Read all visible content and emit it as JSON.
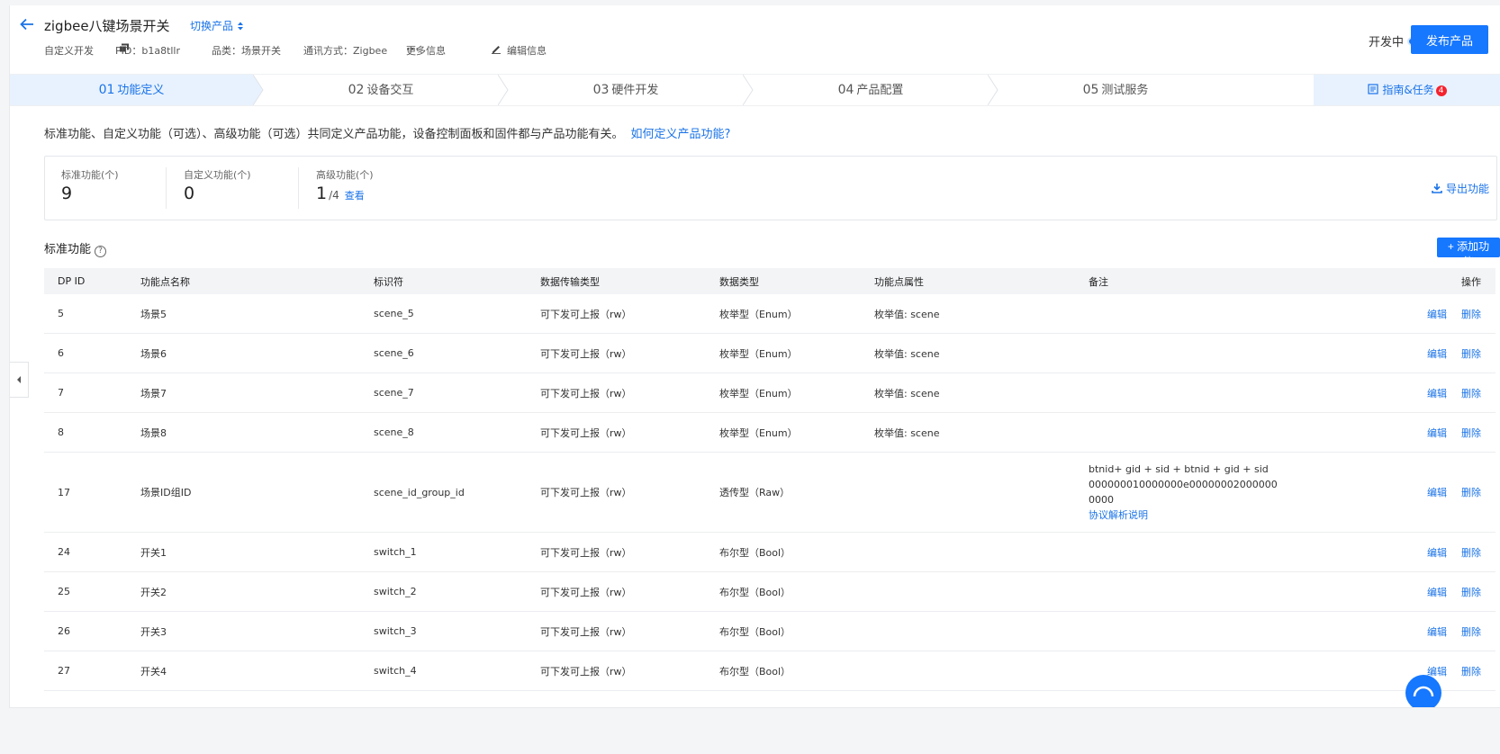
{
  "header": {
    "title": "zigbee八键场景开关",
    "switch_product": "切换产品",
    "meta": {
      "dev_type": "自定义开发",
      "pid": "PID：b1a8tllr",
      "category": "品类：场景开关",
      "protocol": "通讯方式：Zigbee",
      "more": "更多信息",
      "edit": "编辑信息"
    },
    "status": "开发中",
    "publish": "发布产品"
  },
  "steps": [
    {
      "num": "01",
      "label": "功能定义"
    },
    {
      "num": "02",
      "label": "设备交互"
    },
    {
      "num": "03",
      "label": "硬件开发"
    },
    {
      "num": "04",
      "label": "产品配置"
    },
    {
      "num": "05",
      "label": "测试服务"
    }
  ],
  "guide": {
    "label": "指南&任务",
    "badge": "4"
  },
  "intro": {
    "text": "标准功能、自定义功能（可选）、高级功能（可选）共同定义产品功能，设备控制面板和固件都与产品功能有关。",
    "link": "如何定义产品功能?"
  },
  "stats": {
    "standard": {
      "label": "标准功能(个)",
      "value": "9"
    },
    "custom": {
      "label": "自定义功能(个)",
      "value": "0"
    },
    "advanced": {
      "label": "高级功能(个)",
      "value": "1",
      "total": "/4",
      "view": "查看"
    },
    "export": "导出功能"
  },
  "section": {
    "title": "标准功能",
    "add": "+ 添加功能"
  },
  "table": {
    "headers": [
      "DP ID",
      "功能点名称",
      "标识符",
      "数据传输类型",
      "数据类型",
      "功能点属性",
      "备注",
      "操作"
    ],
    "edit": "编辑",
    "delete": "删除",
    "rows": [
      {
        "id": "5",
        "name": "场景5",
        "code": "scene_5",
        "mode": "可下发可上报（rw）",
        "type": "枚举型（Enum）",
        "attr": "枚举值: scene"
      },
      {
        "id": "6",
        "name": "场景6",
        "code": "scene_6",
        "mode": "可下发可上报（rw）",
        "type": "枚举型（Enum）",
        "attr": "枚举值: scene"
      },
      {
        "id": "7",
        "name": "场景7",
        "code": "scene_7",
        "mode": "可下发可上报（rw）",
        "type": "枚举型（Enum）",
        "attr": "枚举值: scene"
      },
      {
        "id": "8",
        "name": "场景8",
        "code": "scene_8",
        "mode": "可下发可上报（rw）",
        "type": "枚举型（Enum）",
        "attr": "枚举值: scene"
      },
      {
        "id": "17",
        "name": "场景ID组ID",
        "code": "scene_id_group_id",
        "mode": "可下发可上报（rw）",
        "type": "透传型（Raw）",
        "attr": "",
        "remark": [
          "btnid+ gid + sid + btnid + gid + sid",
          "000000010000000e00000002000000",
          "0000"
        ],
        "remark_link": "协议解析说明"
      },
      {
        "id": "24",
        "name": "开关1",
        "code": "switch_1",
        "mode": "可下发可上报（rw）",
        "type": "布尔型（Bool）",
        "attr": ""
      },
      {
        "id": "25",
        "name": "开关2",
        "code": "switch_2",
        "mode": "可下发可上报（rw）",
        "type": "布尔型（Bool）",
        "attr": ""
      },
      {
        "id": "26",
        "name": "开关3",
        "code": "switch_3",
        "mode": "可下发可上报（rw）",
        "type": "布尔型（Bool）",
        "attr": ""
      },
      {
        "id": "27",
        "name": "开关4",
        "code": "switch_4",
        "mode": "可下发可上报（rw）",
        "type": "布尔型（Bool）",
        "attr": ""
      }
    ]
  },
  "colors": {
    "primary": "#1677ff",
    "step_active_bg": "#e8f2ff",
    "badge": "#f5222d"
  }
}
